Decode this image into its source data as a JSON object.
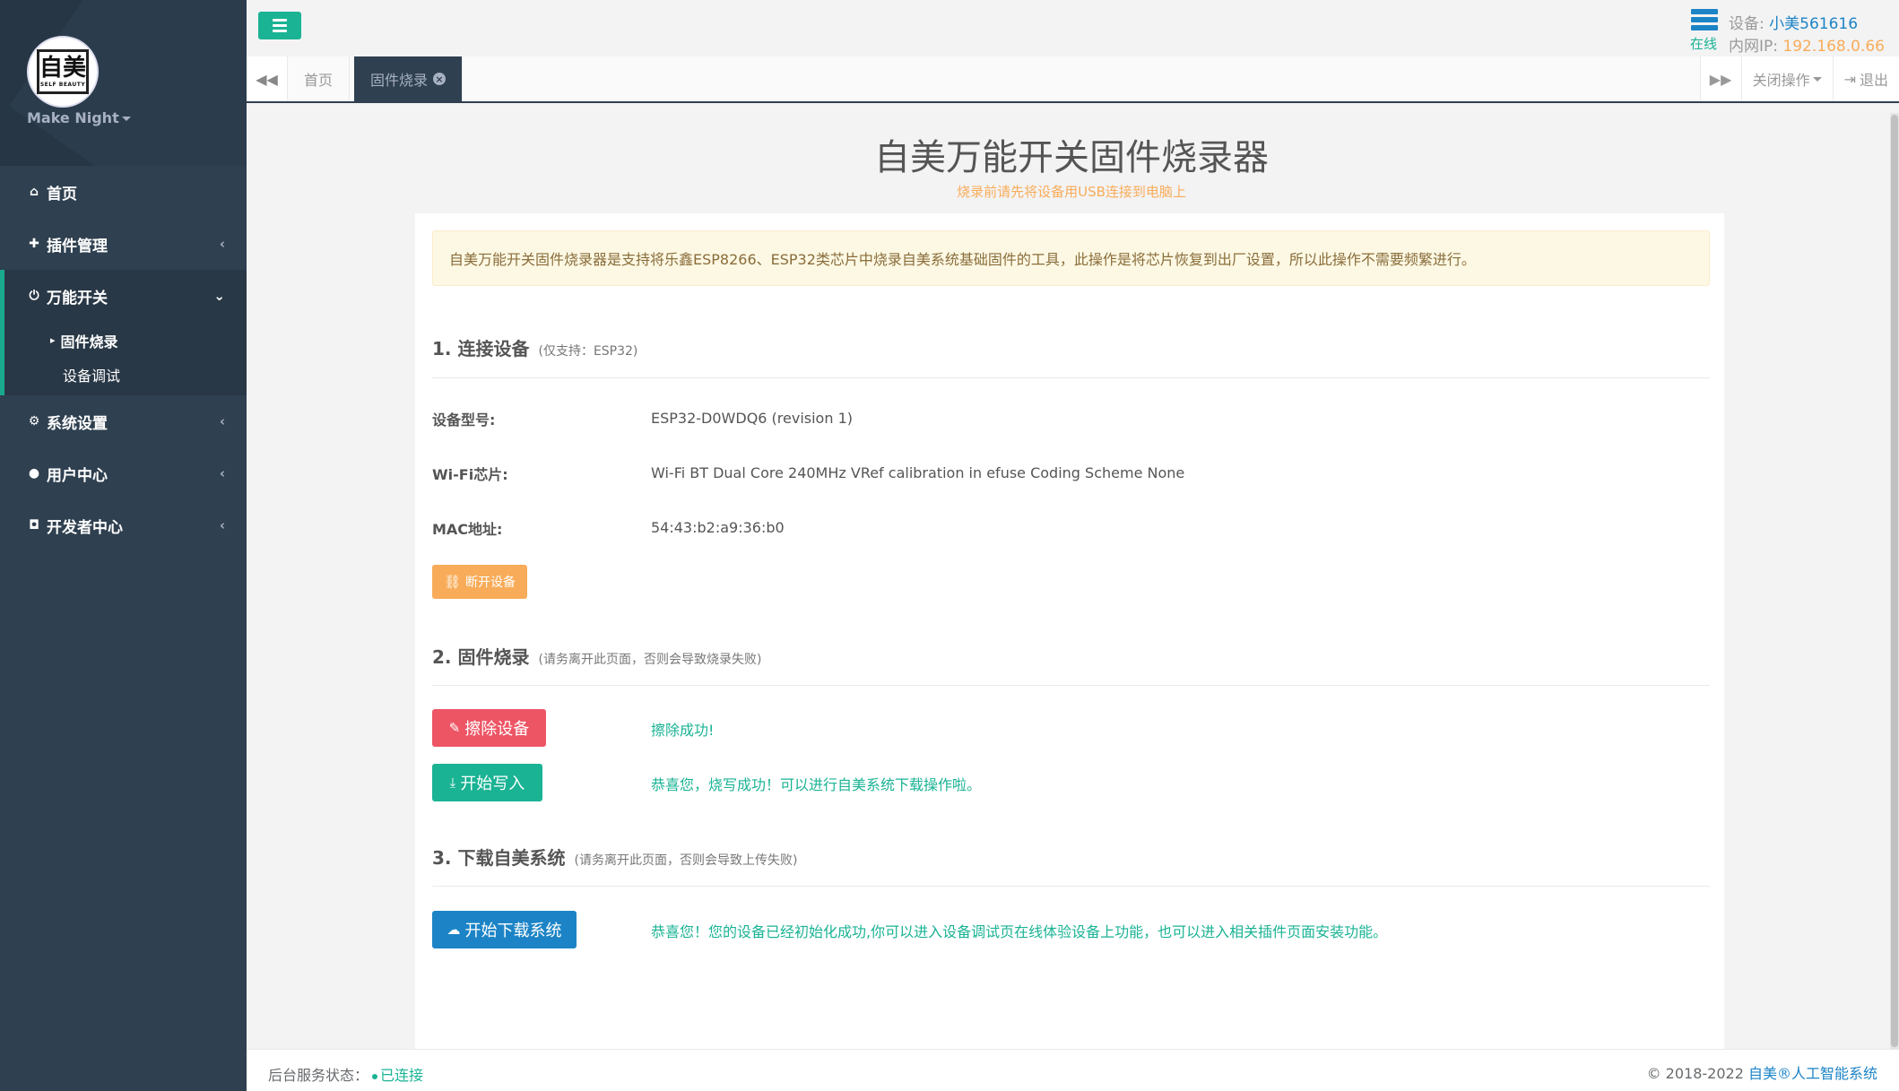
{
  "sidebar": {
    "logo_text": "自美",
    "logo_sub": "SELF BEAUTY",
    "user_name": "Make Night",
    "items": [
      {
        "label": "首页",
        "icon": "home-icon"
      },
      {
        "label": "插件管理",
        "icon": "puzzle-icon"
      },
      {
        "label": "万能开关",
        "icon": "power-icon"
      },
      {
        "label": "系统设置",
        "icon": "gear-icon"
      },
      {
        "label": "用户中心",
        "icon": "user-icon"
      },
      {
        "label": "开发者中心",
        "icon": "github-icon"
      }
    ],
    "sub_items": [
      {
        "label": "固件烧录"
      },
      {
        "label": "设备调试"
      }
    ]
  },
  "topbar": {
    "device_label": "设备:",
    "device_value": "小美561616",
    "online": "在线",
    "ip_label": "内网IP:",
    "ip_value": "192.168.0.66"
  },
  "tabs": {
    "home": "首页",
    "active": "固件烧录",
    "close_ops": "关闭操作",
    "logout": "退出"
  },
  "page": {
    "title": "自美万能开关固件烧录器",
    "subtitle": "烧录前请先将设备用USB连接到电脑上",
    "alert": "自美万能开关固件烧录器是支持将乐鑫ESP8266、ESP32类芯片中烧录自美系统基础固件的工具，此操作是将芯片恢复到出厂设置，所以此操作不需要频繁进行。"
  },
  "section1": {
    "title": "1. 连接设备",
    "note": "(仅支持：ESP32)",
    "model_label": "设备型号:",
    "model_value": "ESP32-D0WDQ6 (revision 1)",
    "wifi_label": "Wi-Fi芯片:",
    "wifi_value": "Wi-Fi BT Dual Core 240MHz VRef calibration in efuse Coding Scheme None",
    "mac_label": "MAC地址:",
    "mac_value": "54:43:b2:a9:36:b0",
    "disconnect_button": "断开设备"
  },
  "section2": {
    "title": "2. 固件烧录",
    "note": "(请务离开此页面，否则会导致烧录失败)",
    "erase_button": "擦除设备",
    "erase_msg": "擦除成功!",
    "write_button": "开始写入",
    "write_msg": "恭喜您，烧写成功！可以进行自美系统下载操作啦。"
  },
  "section3": {
    "title": "3. 下载自美系统",
    "note": "(请务离开此页面，否则会导致上传失败)",
    "download_button": "开始下载系统",
    "download_msg": "恭喜您！您的设备已经初始化成功,你可以进入设备调试页在线体验设备上功能，也可以进入相关插件页面安装功能。"
  },
  "footer": {
    "status_label": "后台服务状态：",
    "status_value": "已连接",
    "copyright": "© 2018-2022",
    "brand": "自美®人工智能系统"
  },
  "colors": {
    "sidebar_bg": "#2f4050",
    "accent_green": "#1ab394",
    "accent_blue": "#1c84c6",
    "warning": "#f8ac59",
    "danger": "#ed5565"
  }
}
